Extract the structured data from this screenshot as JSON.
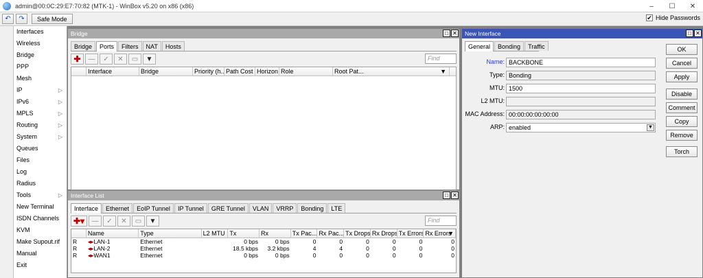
{
  "window": {
    "title": "admin@00:0C:29:E7:70:82 (MTK-1) - WinBox v5.20 on x86 (x86)",
    "controls": [
      "–",
      "☐",
      "✕"
    ]
  },
  "toolbar": {
    "undo_label": "↶",
    "redo_label": "↷",
    "safe_mode_label": "Safe Mode",
    "hide_passwords_label": "Hide Passwords",
    "hide_passwords_checked": "✔"
  },
  "sidebar": {
    "items": [
      {
        "label": "Interfaces",
        "arrow": ""
      },
      {
        "label": "Wireless",
        "arrow": ""
      },
      {
        "label": "Bridge",
        "arrow": ""
      },
      {
        "label": "PPP",
        "arrow": ""
      },
      {
        "label": "Mesh",
        "arrow": ""
      },
      {
        "label": "IP",
        "arrow": "▷"
      },
      {
        "label": "IPv6",
        "arrow": "▷"
      },
      {
        "label": "MPLS",
        "arrow": "▷"
      },
      {
        "label": "Routing",
        "arrow": "▷"
      },
      {
        "label": "System",
        "arrow": "▷"
      },
      {
        "label": "Queues",
        "arrow": ""
      },
      {
        "label": "Files",
        "arrow": ""
      },
      {
        "label": "Log",
        "arrow": ""
      },
      {
        "label": "Radius",
        "arrow": ""
      },
      {
        "label": "Tools",
        "arrow": "▷"
      },
      {
        "label": "New Terminal",
        "arrow": ""
      },
      {
        "label": "ISDN Channels",
        "arrow": ""
      },
      {
        "label": "KVM",
        "arrow": ""
      },
      {
        "label": "Make Supout.rif",
        "arrow": ""
      },
      {
        "label": "Manual",
        "arrow": ""
      },
      {
        "label": "Exit",
        "arrow": ""
      }
    ]
  },
  "bridge_window": {
    "title": "Bridge",
    "tabs": [
      "Bridge",
      "Ports",
      "Filters",
      "NAT",
      "Hosts"
    ],
    "active_tab": "Ports",
    "find_placeholder": "Find",
    "columns": [
      "",
      "Interface",
      "Bridge",
      "Priority (h...",
      "Path Cost",
      "Horizon",
      "Role",
      "Root Pat..."
    ],
    "rows": []
  },
  "interface_list_window": {
    "title": "Interface List",
    "tabs": [
      "Interface",
      "Ethernet",
      "EoIP Tunnel",
      "IP Tunnel",
      "GRE Tunnel",
      "VLAN",
      "VRRP",
      "Bonding",
      "LTE"
    ],
    "active_tab": "Interface",
    "find_placeholder": "Find",
    "columns": [
      "",
      "Name",
      "Type",
      "L2 MTU",
      "Tx",
      "Rx",
      "Tx Pac...",
      "Rx Pac...",
      "Tx Drops",
      "Rx Drops",
      "Tx Errors",
      "Rx Errors"
    ],
    "rows": [
      {
        "flag": "R",
        "name": "LAN-1",
        "type": "Ethernet",
        "l2mtu": "",
        "tx": "0 bps",
        "rx": "0 bps",
        "txp": "0",
        "rxp": "0",
        "txd": "0",
        "rxd": "0",
        "txe": "0",
        "rxe": "0"
      },
      {
        "flag": "R",
        "name": "LAN-2",
        "type": "Ethernet",
        "l2mtu": "",
        "tx": "18.5 kbps",
        "rx": "3.2 kbps",
        "txp": "4",
        "rxp": "4",
        "txd": "0",
        "rxd": "0",
        "txe": "0",
        "rxe": "0"
      },
      {
        "flag": "R",
        "name": "WAN1",
        "type": "Ethernet",
        "l2mtu": "",
        "tx": "0 bps",
        "rx": "0 bps",
        "txp": "0",
        "rxp": "0",
        "txd": "0",
        "rxd": "0",
        "txe": "0",
        "rxe": "0"
      }
    ]
  },
  "new_interface_window": {
    "title": "New Interface",
    "tabs": [
      "General",
      "Bonding",
      "Traffic"
    ],
    "active_tab": "General",
    "fields": {
      "name": {
        "label": "Name:",
        "value": "BACKBONE"
      },
      "type": {
        "label": "Type:",
        "value": "Bonding"
      },
      "mtu": {
        "label": "MTU:",
        "value": "1500"
      },
      "l2mtu": {
        "label": "L2 MTU:",
        "value": ""
      },
      "mac": {
        "label": "MAC Address:",
        "value": "00:00:00:00:00:00"
      },
      "arp": {
        "label": "ARP:",
        "value": "enabled"
      }
    },
    "buttons": {
      "ok": "OK",
      "cancel": "Cancel",
      "apply": "Apply",
      "disable": "Disable",
      "comment": "Comment",
      "copy": "Copy",
      "remove": "Remove",
      "torch": "Torch"
    }
  }
}
